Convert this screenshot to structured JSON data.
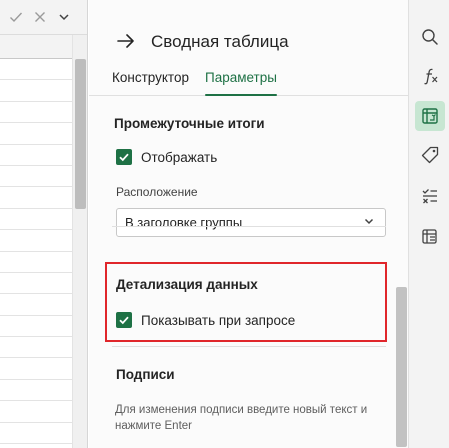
{
  "formula_bar": {
    "confirm_icon": "check-icon",
    "cancel_icon": "close-icon",
    "expand_icon": "chevron-down-icon"
  },
  "pane": {
    "back_icon": "arrow-right-icon",
    "title": "Сводная таблица",
    "tabs": [
      {
        "label": "Конструктор",
        "active": false
      },
      {
        "label": "Параметры",
        "active": true
      }
    ],
    "subtotals": {
      "section_title": "Промежуточные итоги",
      "show_checkbox_label": "Отображать",
      "show_checked": true,
      "location_label": "Расположение",
      "location_value": "В заголовке группы"
    },
    "drilldown": {
      "section_title": "Детализация данных",
      "checkbox_label": "Показывать при запросе",
      "checked": true
    },
    "captions": {
      "section_title": "Подписи",
      "help_text": "Для изменения подписи введите новый текст и нажмите Enter"
    }
  },
  "rail": [
    {
      "name": "search-icon",
      "active": false
    },
    {
      "name": "function-icon",
      "active": false
    },
    {
      "name": "pivot-table-icon",
      "active": true
    },
    {
      "name": "tag-icon",
      "active": false
    },
    {
      "name": "check-list-icon",
      "active": false
    },
    {
      "name": "table-formula-icon",
      "active": false
    }
  ],
  "colors": {
    "accent": "#1e7145",
    "highlight_box": "#e0262b",
    "active_rail_bg": "#c7e6d2"
  }
}
